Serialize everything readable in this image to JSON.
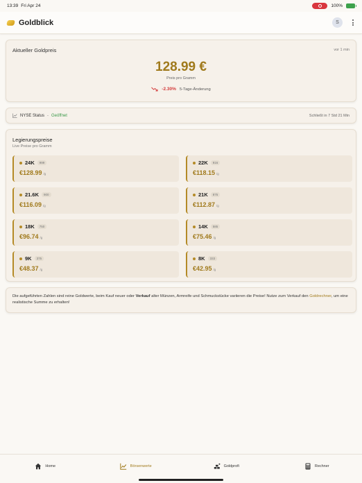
{
  "statusbar": {
    "time": "13:39",
    "date": "Fri Apr 24",
    "battery": "100%"
  },
  "app": {
    "title": "Goldblick",
    "avatar_initial": "S"
  },
  "price_card": {
    "label": "Aktueller Goldpreis",
    "updated": "vor 1 min",
    "price": "128.99 €",
    "unit": "Preis pro Gramm",
    "change_pct": "-2.30%",
    "change_period": "5-Tage-Änderung"
  },
  "nyse": {
    "label": "NYSE Status",
    "separator": "-",
    "status": "Geöffnet",
    "closes": "Schließt in 7 Std 21 Min"
  },
  "alloys": {
    "heading": "Legierungspreise",
    "subheading": "Live Preise pro Gramm",
    "per_unit": "/g",
    "items": [
      {
        "karat": "24K",
        "fineness": "999",
        "value": "€128.99"
      },
      {
        "karat": "22K",
        "fineness": "916",
        "value": "€118.15"
      },
      {
        "karat": "21.6K",
        "fineness": "900",
        "value": "€116.09"
      },
      {
        "karat": "21K",
        "fineness": "875",
        "value": "€112.87"
      },
      {
        "karat": "18K",
        "fineness": "750",
        "value": "€96.74"
      },
      {
        "karat": "14K",
        "fineness": "585",
        "value": "€75.46"
      },
      {
        "karat": "9K",
        "fineness": "375",
        "value": "€48.37"
      },
      {
        "karat": "8K",
        "fineness": "333",
        "value": "€42.95"
      }
    ]
  },
  "note": {
    "part1": "Die aufgeführten Zahlen sind reine Goldwerte, beim Kauf neuer oder ",
    "bold": "Verkauf",
    "part2": " alter Münzen, Armreife und Schmuckstücke variieren die Preise! Nutze zum Verkauf den ",
    "link": "Goldrechner",
    "part3": ", um eine realistische Summe zu erhalten!"
  },
  "nav": {
    "home": "Home",
    "boersenwerte": "Börsenwerte",
    "goldprofi": "Goldprofi",
    "rechner": "Rechner"
  },
  "colors": {
    "gold": "#a07a1c",
    "accent_border": "#b48a26",
    "negative": "#d33a3a",
    "positive": "#3c9a4a"
  }
}
